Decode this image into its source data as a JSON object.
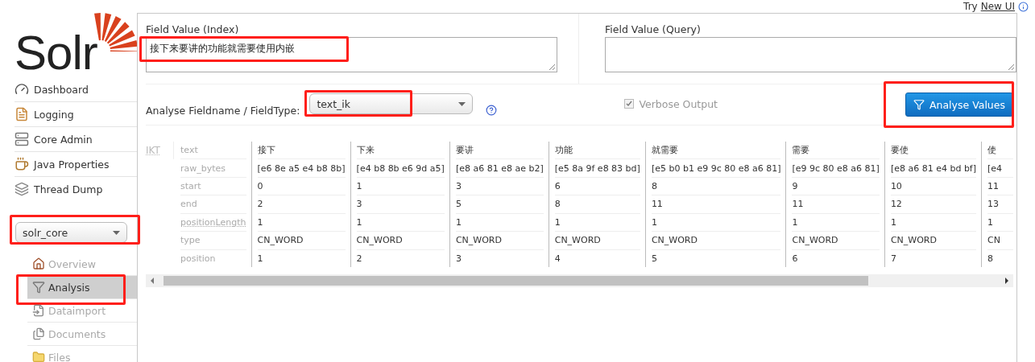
{
  "header": {
    "try_text": "Try",
    "new_ui_link": "New UI"
  },
  "sidebar": {
    "logo": "Solr",
    "nav": [
      {
        "label": "Dashboard"
      },
      {
        "label": "Logging"
      },
      {
        "label": "Core Admin"
      },
      {
        "label": "Java Properties"
      },
      {
        "label": "Thread Dump"
      }
    ],
    "core_select": {
      "value": "solr_core",
      "highlighted": true
    },
    "core_nav": [
      {
        "label": "Overview",
        "selected": false,
        "highlighted": false
      },
      {
        "label": "Analysis",
        "selected": true,
        "highlighted": true
      },
      {
        "label": "Dataimport",
        "selected": false,
        "highlighted": false
      },
      {
        "label": "Documents",
        "selected": false,
        "highlighted": false
      },
      {
        "label": "Files",
        "selected": false,
        "highlighted": false
      }
    ]
  },
  "form": {
    "index_field": {
      "label": "Field Value (Index)",
      "value": "接下来要讲的功能就需要使用内嵌",
      "highlighted": true
    },
    "query_field": {
      "label": "Field Value (Query)"
    },
    "fieldtype": {
      "label": "Analyse Fieldname / FieldType:",
      "value": "text_ik",
      "highlighted": true
    },
    "verbose": {
      "label": "Verbose Output",
      "checked": true
    },
    "analyse_button": {
      "label": "Analyse Values",
      "highlighted": true
    }
  },
  "analysis": {
    "tokenizer": "IKT",
    "attributes": [
      "text",
      "raw_bytes",
      "start",
      "end",
      "positionLength",
      "type",
      "position"
    ],
    "tokens": [
      {
        "values": [
          "接下",
          "[e6 8e a5 e4 b8 8b]",
          "0",
          "2",
          "1",
          "CN_WORD",
          "1"
        ]
      },
      {
        "values": [
          "下来",
          "[e4 b8 8b e6 9d a5]",
          "1",
          "3",
          "1",
          "CN_WORD",
          "2"
        ]
      },
      {
        "values": [
          "要讲",
          "[e8 a6 81 e8 ae b2]",
          "3",
          "5",
          "1",
          "CN_WORD",
          "3"
        ]
      },
      {
        "values": [
          "功能",
          "[e5 8a 9f e8 83 bd]",
          "6",
          "8",
          "1",
          "CN_WORD",
          "4"
        ]
      },
      {
        "values": [
          "就需要",
          "[e5 b0 b1 e9 9c 80 e8 a6 81]",
          "8",
          "11",
          "1",
          "CN_WORD",
          "5"
        ]
      },
      {
        "values": [
          "需要",
          "[e9 9c 80 e8 a6 81]",
          "9",
          "11",
          "1",
          "CN_WORD",
          "6"
        ]
      },
      {
        "values": [
          "要使",
          "[e8 a6 81 e4 bd bf]",
          "10",
          "12",
          "1",
          "CN_WORD",
          "7"
        ]
      },
      {
        "values": [
          "使",
          "[e4",
          "11",
          "13",
          "1",
          "CN",
          "8"
        ]
      }
    ]
  }
}
